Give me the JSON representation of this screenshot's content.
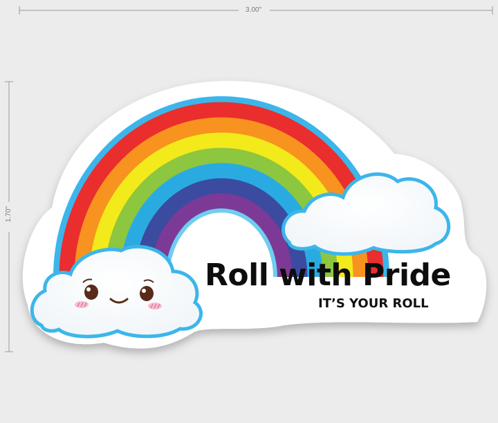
{
  "dimensions": {
    "width_label": "3.00\"",
    "height_label": "1.70\""
  },
  "sticker": {
    "title": "Roll with Pride",
    "subtitle": "IT’S YOUR ROLL",
    "rainbow_colors": [
      "#ea2d2d",
      "#f7931e",
      "#f2ea1b",
      "#8dc63f",
      "#29abe2",
      "#3b4ba0",
      "#7c3a96"
    ],
    "cloud_outline_color": "#3cb6ea",
    "icons": [
      "rainbow-icon",
      "happy-cloud-icon",
      "cloud-icon"
    ]
  }
}
